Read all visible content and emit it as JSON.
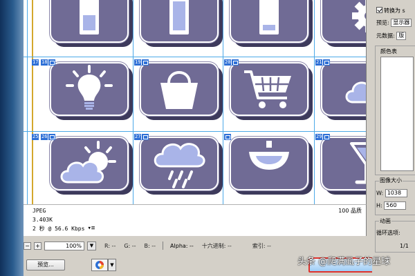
{
  "canvas": {
    "slices": {
      "s17": "17",
      "s18": "18",
      "s19": "19",
      "s20": "20",
      "s21": "21",
      "s25": "25",
      "s26": "26",
      "s27": "27",
      "s28": "28",
      "s29": "29"
    }
  },
  "info": {
    "format": "JPEG",
    "size": "3.403K",
    "time": "2 秒 @ 56.6 Kbps",
    "quality": "100 品质"
  },
  "toolbar": {
    "zoom": "100%",
    "r": "R: --",
    "g": "G: --",
    "b": "B: --",
    "alpha": "Alpha: --",
    "hex": "十六进制: --",
    "index": "索引: --",
    "preview_label": "预览..."
  },
  "panel": {
    "convert_label": "转换为 s",
    "preview_label": "预览:",
    "preview_value": "显示器",
    "metadata_label": "元数据:",
    "metadata_value": "版",
    "color_table_label": "颜色表",
    "image_size_label": "图像大小",
    "width_label": "W:",
    "width_value": "1038",
    "height_label": "H:",
    "height_value": "560",
    "animation_label": "动画",
    "loop_label": "循环选项:",
    "frame_counter": "1/1"
  },
  "icons": {
    "tiles": [
      "battery-half-icon",
      "battery-full-icon",
      "battery-low-icon",
      "gear-icon",
      "lightbulb-icon",
      "shopping-basket-icon",
      "shopping-cart-icon",
      "cloud-icon",
      "sun-cloud-icon",
      "rain-cloud-icon",
      "lamp-icon",
      "cocktail-icon"
    ]
  },
  "colors": {
    "tile": "#706b95",
    "tile_shadow": "#3d3a5c",
    "accent": "#a9b4e8",
    "slice": "#2d6fd6",
    "highlight": "#e0312a"
  },
  "watermark": "头条 @爬满虱子的星球"
}
